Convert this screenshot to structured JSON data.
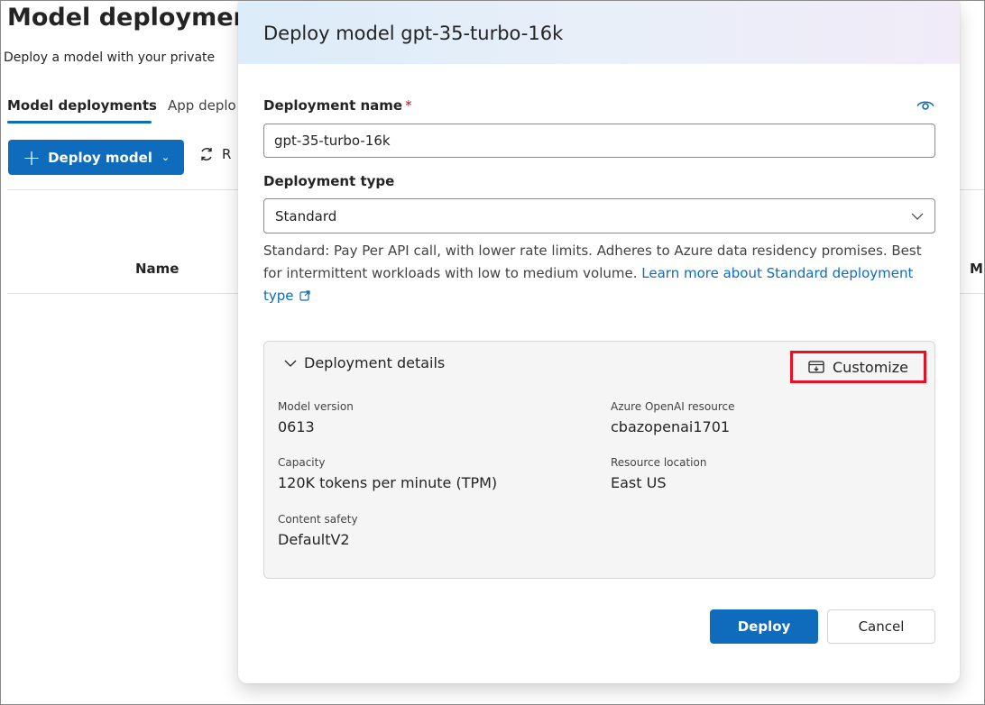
{
  "background": {
    "title": "Model deployment",
    "subtitle": "Deploy a model with your private",
    "tabs": [
      {
        "label": "Model deployments",
        "active": true
      },
      {
        "label": "App deplo",
        "active": false
      }
    ],
    "toolbar": {
      "deploy_label": "Deploy model",
      "refresh_label": "R"
    },
    "table": {
      "columns": [
        "Name",
        "M"
      ]
    }
  },
  "dialog": {
    "title": "Deploy model gpt-35-turbo-16k",
    "deployment_name": {
      "label": "Deployment name",
      "required_mark": "*",
      "value": "gpt-35-turbo-16k"
    },
    "deployment_type": {
      "label": "Deployment type",
      "selected": "Standard"
    },
    "description": {
      "text": "Standard: Pay Per API call, with lower rate limits. Adheres to Azure data residency promises. Best for intermittent workloads with low to medium volume.",
      "link_text": "Learn more about Standard deployment type"
    },
    "details": {
      "toggle_label": "Deployment details",
      "customize_label": "Customize",
      "fields": {
        "model_version": {
          "label": "Model version",
          "value": "0613"
        },
        "azure_resource": {
          "label": "Azure OpenAI resource",
          "value": "cbazopenai1701"
        },
        "capacity": {
          "label": "Capacity",
          "value": "120K tokens per minute (TPM)"
        },
        "resource_location": {
          "label": "Resource location",
          "value": "East US"
        },
        "content_safety": {
          "label": "Content safety",
          "value": "DefaultV2"
        }
      }
    },
    "actions": {
      "deploy_label": "Deploy",
      "cancel_label": "Cancel"
    }
  },
  "colors": {
    "brand": "#0f6cbd",
    "highlight": "#e81123",
    "required": "#c50f1f"
  }
}
